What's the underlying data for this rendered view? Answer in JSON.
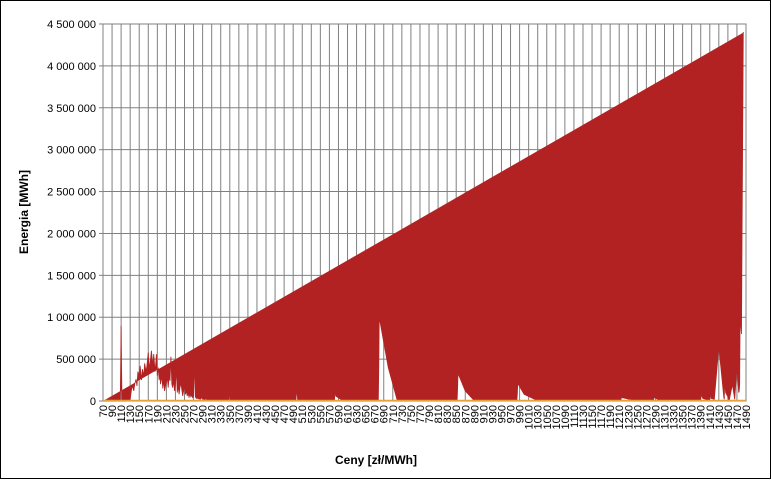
{
  "chart_data": {
    "type": "area",
    "xlabel": "Ceny [zł/MWh]",
    "ylabel": "Energia [MWh]",
    "ylim": [
      0,
      4500000
    ],
    "y_ticks": [
      0,
      500000,
      1000000,
      1500000,
      2000000,
      2500000,
      3000000,
      3500000,
      4000000,
      4500000
    ],
    "y_tick_labels": [
      "0",
      "500 000",
      "1 000 000",
      "1 500 000",
      "2 000 000",
      "2 500 000",
      "3 000 000",
      "3 500 000",
      "4 000 000",
      "4 500 000"
    ],
    "x_tick_labels": [
      "70",
      "90",
      "110",
      "130",
      "150",
      "170",
      "190",
      "210",
      "230",
      "250",
      "270",
      "290",
      "310",
      "330",
      "350",
      "370",
      "390",
      "410",
      "430",
      "450",
      "470",
      "490",
      "510",
      "530",
      "550",
      "570",
      "590",
      "610",
      "630",
      "650",
      "670",
      "690",
      "710",
      "730",
      "750",
      "770",
      "790",
      "810",
      "830",
      "850",
      "870",
      "890",
      "910",
      "930",
      "950",
      "970",
      "990",
      "1010",
      "1030",
      "1050",
      "1070",
      "1090",
      "1110",
      "1130",
      "1150",
      "1170",
      "1190",
      "1210",
      "1230",
      "1250",
      "1270",
      "1290",
      "1310",
      "1330",
      "1350",
      "1370",
      "1390",
      "1410",
      "1430",
      "1450",
      "1470",
      "1490"
    ],
    "xlim": [
      70,
      1490
    ],
    "grid": true,
    "colors": {
      "series_fill": "#b22222",
      "baseline": "#e8a13a"
    },
    "x": [
      70,
      90,
      108,
      109,
      110,
      111,
      112,
      120,
      130,
      131,
      133,
      135,
      138,
      140,
      143,
      145,
      147,
      150,
      152,
      155,
      157,
      160,
      162,
      165,
      167,
      170,
      172,
      175,
      177,
      180,
      182,
      185,
      187,
      188,
      190,
      192,
      194,
      195,
      197,
      200,
      202,
      204,
      206,
      208,
      210,
      212,
      214,
      216,
      218,
      220,
      222,
      224,
      226,
      228,
      230,
      232,
      234,
      236,
      238,
      240,
      242,
      244,
      246,
      248,
      250,
      252,
      254,
      256,
      258,
      260,
      262,
      264,
      266,
      268,
      270,
      272,
      274,
      276,
      278,
      280,
      282,
      284,
      286,
      288,
      290,
      292,
      294,
      296,
      298,
      300,
      305,
      310,
      315,
      320,
      330,
      340,
      348,
      349,
      350,
      351,
      352,
      360,
      380,
      400,
      420,
      440,
      460,
      480,
      496,
      497,
      498,
      499,
      500,
      520,
      540,
      560,
      581,
      582,
      583,
      584,
      600,
      620,
      640,
      660,
      676,
      677,
      678,
      679,
      680,
      700,
      720,
      740,
      760,
      780,
      800,
      820,
      850,
      851,
      852,
      853,
      854,
      870,
      890,
      910,
      930,
      950,
      970,
      982,
      983,
      984,
      985,
      986,
      1000,
      1030,
      1060,
      1090,
      1120,
      1150,
      1180,
      1210,
      1213,
      1214,
      1215,
      1216,
      1250,
      1280,
      1285,
      1286,
      1287,
      1288,
      1300,
      1330,
      1360,
      1380,
      1390,
      1391,
      1392,
      1395,
      1410,
      1411,
      1412,
      1413,
      1420,
      1430,
      1440,
      1441,
      1442,
      1443,
      1445,
      1450,
      1451,
      1452,
      1453,
      1460,
      1465,
      1470,
      1474,
      1475,
      1476,
      1477,
      1480,
      1484,
      1485,
      1486,
      1487,
      1488,
      1489,
      1490
    ],
    "values": [
      0,
      0,
      0,
      400000,
      900000,
      400000,
      0,
      0,
      20000,
      60000,
      140000,
      180000,
      120000,
      200000,
      260000,
      180000,
      350000,
      300000,
      420000,
      250000,
      380000,
      300000,
      450000,
      350000,
      420000,
      580000,
      380000,
      500000,
      600000,
      420000,
      560000,
      350000,
      480000,
      560000,
      300000,
      400000,
      250000,
      380000,
      200000,
      300000,
      150000,
      250000,
      120000,
      180000,
      220000,
      280000,
      160000,
      300000,
      240000,
      530000,
      200000,
      160000,
      250000,
      120000,
      200000,
      380000,
      100000,
      180000,
      80000,
      160000,
      220000,
      140000,
      60000,
      120000,
      180000,
      80000,
      120000,
      60000,
      100000,
      40000,
      90000,
      50000,
      70000,
      40000,
      60000,
      470000,
      50000,
      30000,
      40000,
      25000,
      30000,
      20000,
      25000,
      40000,
      30000,
      20000,
      15000,
      25000,
      20000,
      15000,
      10000,
      20000,
      10000,
      15000,
      10000,
      10000,
      8000,
      300000,
      60000,
      8000,
      6000,
      8000,
      5000,
      6000,
      4000,
      5000,
      3000,
      5000,
      3000,
      80000,
      170000,
      80000,
      5000,
      3000,
      4000,
      2000,
      3000,
      80000,
      180000,
      60000,
      2000,
      3000,
      2000,
      2000,
      2000,
      2000,
      2000,
      400000,
      1000000,
      400000,
      3000,
      2000,
      3000,
      2000,
      3000,
      2000,
      3000,
      3000,
      2000,
      140000,
      330000,
      120000,
      3000,
      2000,
      5000,
      3000,
      6000,
      3000,
      60000,
      2000,
      90000,
      210000,
      80000,
      3000,
      5000,
      3000,
      5000,
      3000,
      5000,
      3000,
      4000,
      5000,
      100000,
      40000,
      3000,
      3000,
      3000,
      5000,
      120000,
      40000,
      3000,
      5000,
      3000,
      10000,
      20000,
      180000,
      60000,
      30000,
      5000,
      280000,
      60000,
      30000,
      20000,
      650000,
      100000,
      40000,
      20000,
      260000,
      100000,
      50000,
      20000,
      30000,
      10000,
      200000,
      20000,
      400000,
      100000,
      120000,
      200000,
      1000000,
      800000,
      4400000,
      4400000
    ]
  }
}
